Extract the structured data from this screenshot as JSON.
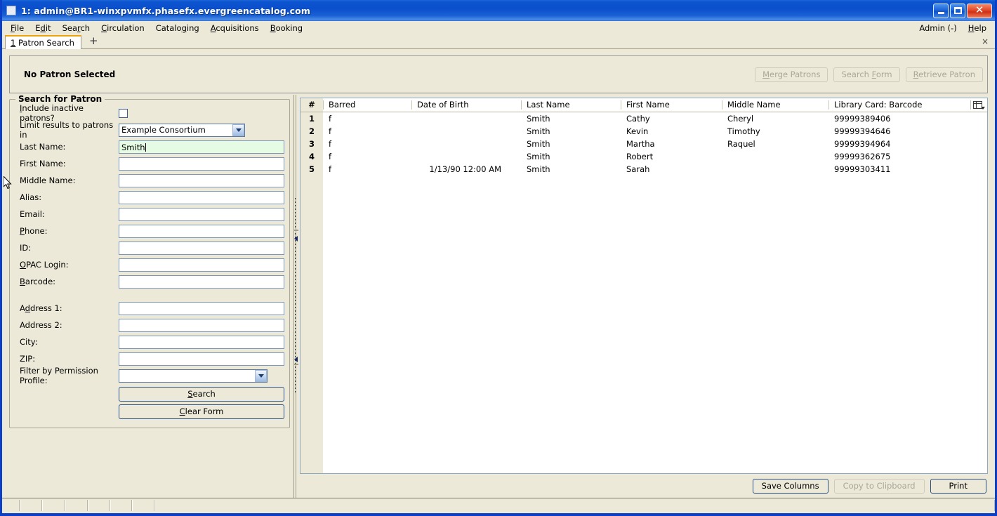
{
  "window": {
    "title": "1: admin@BR1-winxpvmfx.phasefx.evergreencatalog.com",
    "minimize_label": "",
    "maximize_label": "",
    "close_label": "✕"
  },
  "menubar": {
    "items": [
      {
        "label": "File",
        "accel_index": 0
      },
      {
        "label": "Edit",
        "accel_index": 1
      },
      {
        "label": "Search",
        "accel_index": 3
      },
      {
        "label": "Circulation",
        "accel_index": 0
      },
      {
        "label": "Cataloging",
        "accel_index": 7
      },
      {
        "label": "Acquisitions",
        "accel_index": 0
      },
      {
        "label": "Booking",
        "accel_index": 0
      }
    ],
    "right_items": [
      {
        "label": "Admin (-)",
        "accel_index": -1
      },
      {
        "label": "Help",
        "accel_index": 0
      }
    ]
  },
  "tabstrip": {
    "tabs": [
      {
        "number": "1",
        "label": "Patron Search"
      }
    ],
    "add_label": "+",
    "close_label": "×"
  },
  "patron_header": {
    "status": "No Patron Selected",
    "buttons": [
      {
        "label": "Merge Patrons",
        "enabled": false
      },
      {
        "label": "Search Form",
        "enabled": false
      },
      {
        "label": "Retrieve Patron",
        "enabled": false
      }
    ]
  },
  "search_form": {
    "legend": "Search for Patron",
    "include_inactive_label": "Include inactive patrons?",
    "include_inactive_checked": false,
    "limit_results_label": "Limit results to patrons in",
    "limit_results_value": "Example Consortium",
    "fields": [
      {
        "label": "Last Name:",
        "value": "Smith",
        "focused": true
      },
      {
        "label": "First Name:",
        "value": "",
        "focused": false
      },
      {
        "label": "Middle Name:",
        "value": "",
        "focused": false
      },
      {
        "label": "Alias:",
        "value": "",
        "focused": false
      },
      {
        "label": "Email:",
        "value": "",
        "focused": false
      },
      {
        "label": "Phone:",
        "value": "",
        "focused": false
      },
      {
        "label": "ID:",
        "value": "",
        "focused": false
      },
      {
        "label": "OPAC Login:",
        "value": "",
        "focused": false
      },
      {
        "label": "Barcode:",
        "value": "",
        "focused": false
      }
    ],
    "address_fields": [
      {
        "label": "Address 1:",
        "value": ""
      },
      {
        "label": "Address 2:",
        "value": ""
      },
      {
        "label": "City:",
        "value": ""
      },
      {
        "label": "ZIP:",
        "value": ""
      }
    ],
    "permission_profile_label": "Filter by Permission Profile:",
    "permission_profile_value": "",
    "search_button": "Search",
    "clear_button": "Clear Form"
  },
  "results": {
    "columns": [
      "#",
      "Barred",
      "Date of Birth",
      "Last Name",
      "First Name",
      "Middle Name",
      "Library Card: Barcode"
    ],
    "column_picker_icon": "column-picker-icon",
    "rows": [
      {
        "num": "1",
        "barred": "f",
        "dob": "",
        "last": "Smith",
        "first": "Cathy",
        "middle": "Cheryl",
        "barcode": "99999389406"
      },
      {
        "num": "2",
        "barred": "f",
        "dob": "",
        "last": "Smith",
        "first": "Kevin",
        "middle": "Timothy",
        "barcode": "99999394646"
      },
      {
        "num": "3",
        "barred": "f",
        "dob": "",
        "last": "Smith",
        "first": "Martha",
        "middle": "Raquel",
        "barcode": "99999394964"
      },
      {
        "num": "4",
        "barred": "f",
        "dob": "",
        "last": "Smith",
        "first": "Robert",
        "middle": "",
        "barcode": "99999362675"
      },
      {
        "num": "5",
        "barred": "f",
        "dob": "1/13/90 12:00 AM",
        "last": "Smith",
        "first": "Sarah",
        "middle": "",
        "barcode": "99999303411"
      }
    ],
    "actions": [
      {
        "label": "Save Columns",
        "enabled": true
      },
      {
        "label": "Copy to Clipboard",
        "enabled": false
      },
      {
        "label": "Print",
        "enabled": true
      }
    ]
  },
  "colors": {
    "titlebar_blue": "#0a4ecb",
    "window_border": "#0b3fc8",
    "chrome_beige": "#ece9d8",
    "tab_accent": "#f0a30a",
    "focused_field_green": "#e6fbe4",
    "button_border": "#2c4f82"
  }
}
